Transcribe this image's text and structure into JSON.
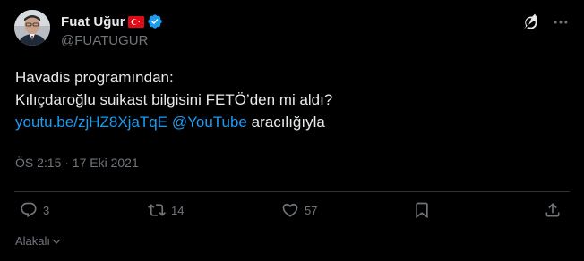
{
  "author": {
    "name": "Fuat Uğur",
    "handle": "@FUATUGUR",
    "verified": true,
    "flag": "turkey-flag"
  },
  "tweet": {
    "line1": "Havadis programından:",
    "line2": "Kılıçdaroğlu suikast bilgisini FETÖ’den mi aldı?",
    "link_url_text": "youtu.be/zjHZ8XjaTqE",
    "mention": "@YouTube",
    "via_text": "aracılığıyla",
    "timestamp": "ÖS 2:15 · 17 Eki 2021"
  },
  "actions": {
    "replies": "3",
    "retweets": "14",
    "likes": "57"
  },
  "footer": {
    "translate_label": "Alakalı"
  },
  "colors": {
    "background": "#000000",
    "text": "#E7E9EA",
    "muted": "#71767B",
    "link": "#1D9BF0",
    "divider": "#2F3336",
    "verified": "#1D9BF0",
    "flag_red": "#E30A17"
  },
  "icons": {
    "grok": "grok-icon",
    "more": "more-icon",
    "reply": "reply-icon",
    "retweet": "retweet-icon",
    "like": "heart-icon",
    "bookmark": "bookmark-icon",
    "share": "share-icon",
    "chevron": "chevron-down-icon"
  }
}
